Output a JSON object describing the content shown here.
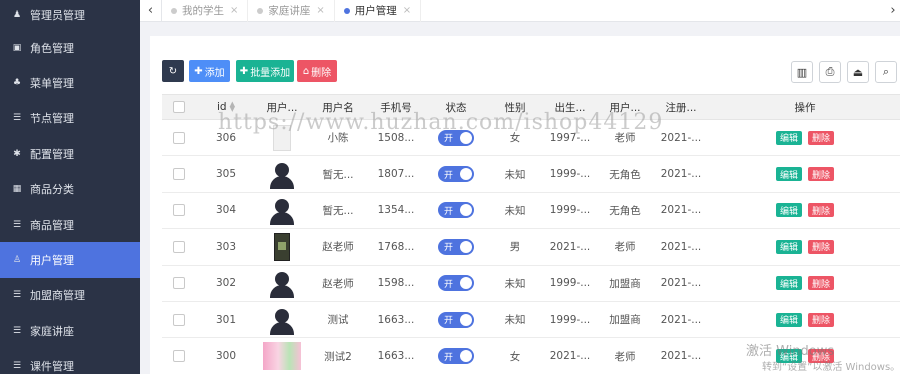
{
  "sidebar": {
    "items": [
      {
        "label": "管理员管理",
        "icon": "user-icon",
        "glyph": "♟",
        "active": false
      },
      {
        "label": "角色管理",
        "icon": "role-icon",
        "glyph": "▣",
        "active": false
      },
      {
        "label": "菜单管理",
        "icon": "tree-icon",
        "glyph": "♣",
        "active": false
      },
      {
        "label": "节点管理",
        "icon": "list-icon",
        "glyph": "☰",
        "active": false
      },
      {
        "label": "配置管理",
        "icon": "gear-icon",
        "glyph": "✱",
        "active": false
      },
      {
        "label": "商品分类",
        "icon": "calendar-icon",
        "glyph": "▦",
        "active": false
      },
      {
        "label": "商品管理",
        "icon": "list-icon",
        "glyph": "☰",
        "active": false
      },
      {
        "label": "用户管理",
        "icon": "user-icon",
        "glyph": "♙",
        "active": true
      },
      {
        "label": "加盟商管理",
        "icon": "list-icon",
        "glyph": "☰",
        "active": false
      },
      {
        "label": "家庭讲座",
        "icon": "list-icon",
        "glyph": "☰",
        "active": false
      },
      {
        "label": "课件管理",
        "icon": "list-icon",
        "glyph": "☰",
        "active": false
      }
    ]
  },
  "tabs": {
    "prev_glyph": "‹",
    "next_glyph": "›",
    "close_glyph": "×",
    "items": [
      {
        "label": "我的学生",
        "active": false
      },
      {
        "label": "家庭讲座",
        "active": false
      },
      {
        "label": "用户管理",
        "active": true
      }
    ]
  },
  "toolbar": {
    "refresh_glyph": "↻",
    "add_label": "添加",
    "batch_add_label": "批量添加",
    "delete_label": "删除",
    "add_glyph": "✚",
    "delete_glyph": "⌂",
    "tools": [
      {
        "name": "columns-icon",
        "glyph": "▥"
      },
      {
        "name": "print-icon",
        "glyph": "⎙"
      },
      {
        "name": "export-icon",
        "glyph": "⏏"
      },
      {
        "name": "search-icon",
        "glyph": "⌕"
      }
    ]
  },
  "table": {
    "headers": [
      "id",
      "用户...",
      "用户名",
      "手机号",
      "状态",
      "性别",
      "出生...",
      "用户...",
      "注册...",
      "操作"
    ],
    "sort_glyphs": [
      "▲",
      "▼"
    ],
    "switch_label": "开",
    "edit_label": "编辑",
    "delete_label": "删除",
    "rows": [
      {
        "id": "306",
        "avatar": "doc",
        "username": "小陈",
        "phone": "1508...",
        "gender": "女",
        "birth": "1997-...",
        "role": "老师",
        "reg": "2021-..."
      },
      {
        "id": "305",
        "avatar": "person",
        "username": "暂无...",
        "phone": "1807...",
        "gender": "未知",
        "birth": "1999-...",
        "role": "无角色",
        "reg": "2021-..."
      },
      {
        "id": "304",
        "avatar": "person",
        "username": "暂无...",
        "phone": "1354...",
        "gender": "未知",
        "birth": "1999-...",
        "role": "无角色",
        "reg": "2021-..."
      },
      {
        "id": "303",
        "avatar": "phone",
        "username": "赵老师",
        "phone": "1768...",
        "gender": "男",
        "birth": "2021-...",
        "role": "老师",
        "reg": "2021-..."
      },
      {
        "id": "302",
        "avatar": "person",
        "username": "赵老师",
        "phone": "1598...",
        "gender": "未知",
        "birth": "1999-...",
        "role": "加盟商",
        "reg": "2021-..."
      },
      {
        "id": "301",
        "avatar": "person",
        "username": "测试",
        "phone": "1663...",
        "gender": "未知",
        "birth": "1999-...",
        "role": "加盟商",
        "reg": "2021-..."
      },
      {
        "id": "300",
        "avatar": "photo",
        "username": "测试2",
        "phone": "1663...",
        "gender": "女",
        "birth": "2021-...",
        "role": "老师",
        "reg": "2021-..."
      }
    ]
  },
  "watermark": "https://www.huzhan.com/ishop44129",
  "windows_notice": {
    "line1": "激活 Windows",
    "line2": "转到“设置”以激活 Windows。"
  },
  "colors": {
    "sidebar_bg": "#2b3346",
    "active": "#4e73df",
    "add": "#4e8ef7",
    "batch": "#1ab394",
    "delete": "#ed5565"
  }
}
